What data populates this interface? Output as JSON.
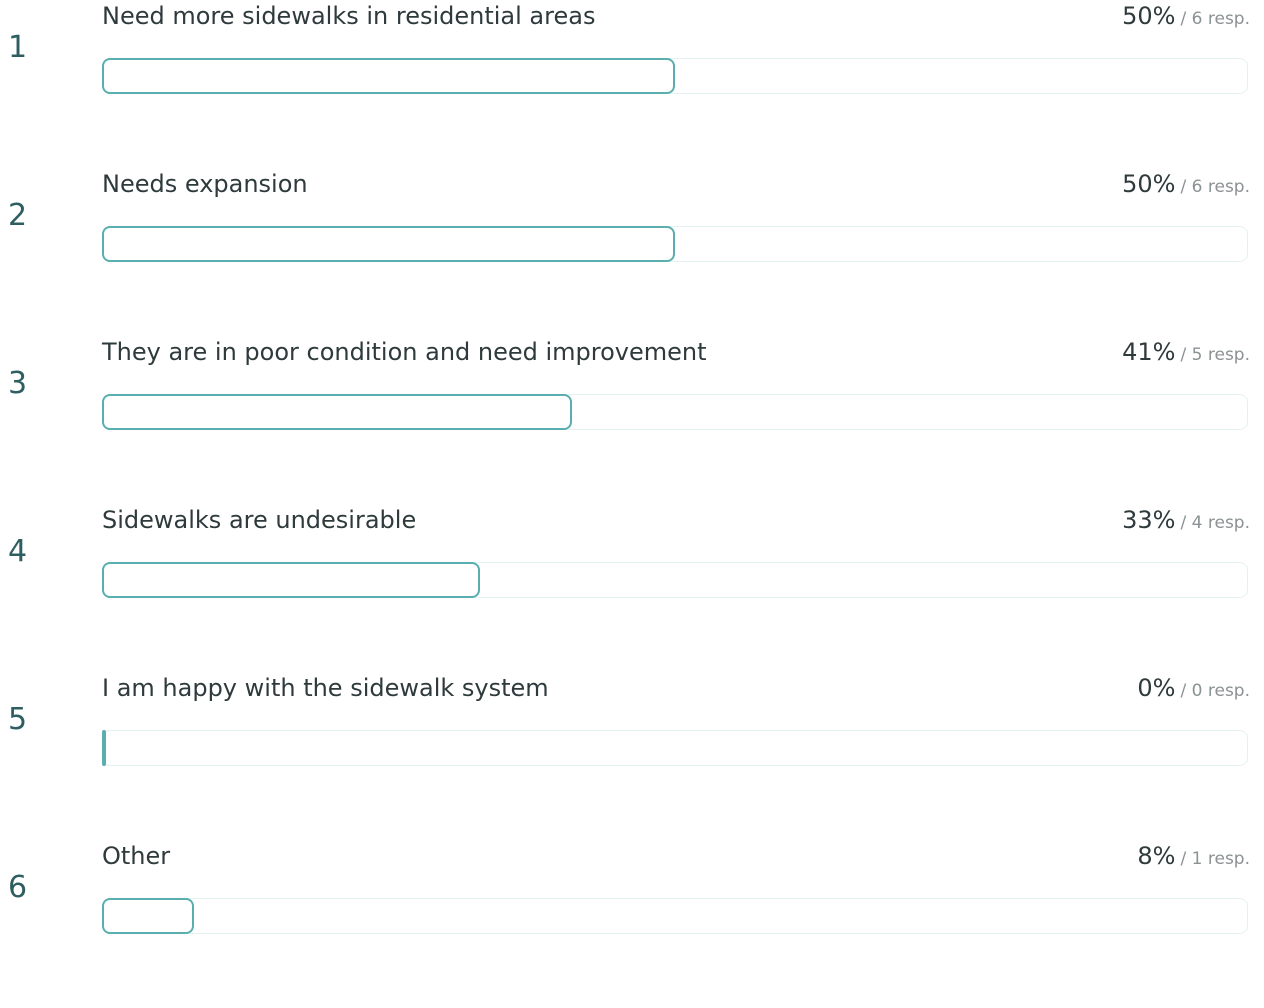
{
  "results": [
    {
      "rank": "1",
      "label": "Need more sidewalks in residential areas",
      "percent_text": "50%",
      "responses_text": "/ 6 resp.",
      "fraction": 0.5
    },
    {
      "rank": "2",
      "label": "Needs expansion",
      "percent_text": "50%",
      "responses_text": "/ 6 resp.",
      "fraction": 0.5
    },
    {
      "rank": "3",
      "label": "They are in poor condition and need improvement",
      "percent_text": "41%",
      "responses_text": "/ 5 resp.",
      "fraction": 0.41
    },
    {
      "rank": "4",
      "label": "Sidewalks are undesirable",
      "percent_text": "33%",
      "responses_text": "/ 4 resp.",
      "fraction": 0.33
    },
    {
      "rank": "5",
      "label": "I am happy with the sidewalk system",
      "percent_text": "0%",
      "responses_text": "/ 0 resp.",
      "fraction": 0
    },
    {
      "rank": "6",
      "label": "Other",
      "percent_text": "8%",
      "responses_text": "/ 1 resp.",
      "fraction": 0.08
    }
  ],
  "colors": {
    "bar_border": "#5aaeb0",
    "track_border": "#e4f1f1",
    "rank_text": "#2e5e60"
  }
}
